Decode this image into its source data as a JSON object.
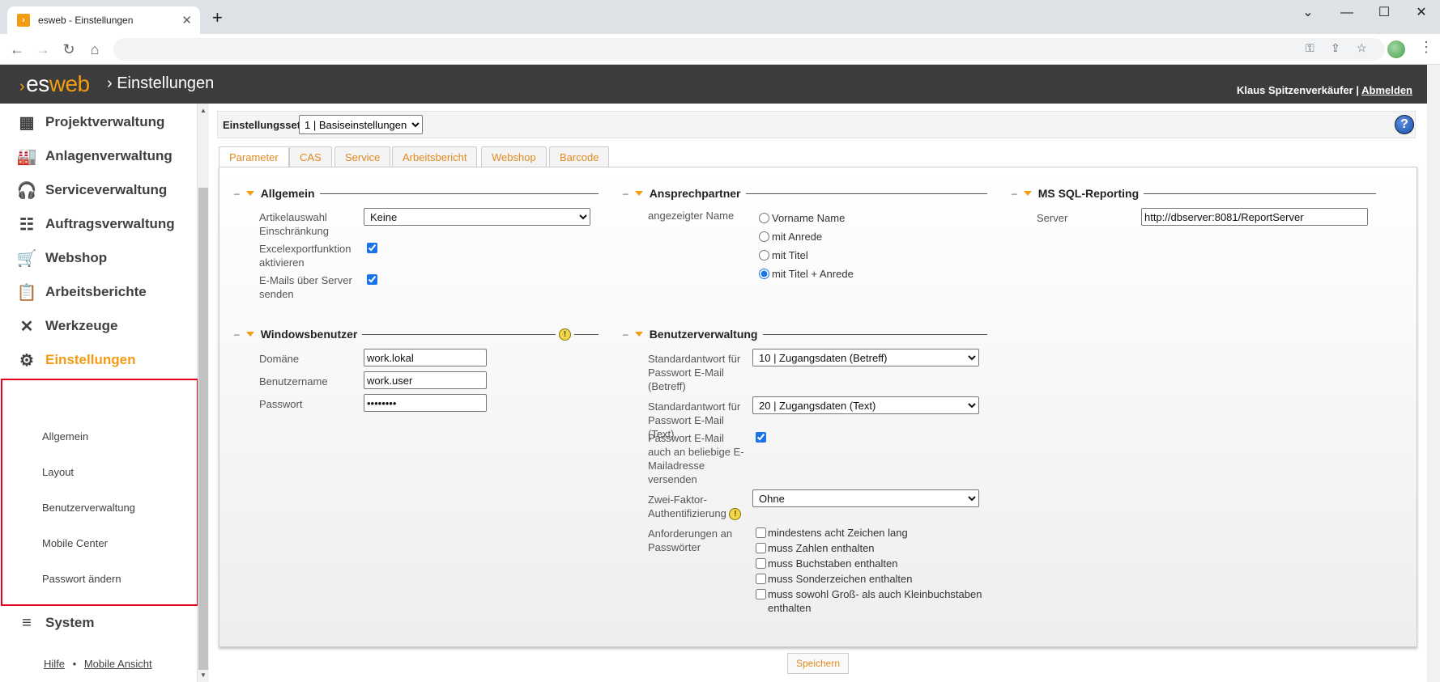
{
  "browser": {
    "tab_title": "esweb - Einstellungen",
    "favicon": "esweb-favicon",
    "new_tab": "+",
    "close_tab": "✕",
    "minimize": "⌄",
    "win_min": "—",
    "win_max": "☐",
    "win_close": "✕"
  },
  "header": {
    "logo_es": "es",
    "logo_web": "web",
    "title": "› Einstellungen",
    "user": "Klaus Spitzenverkäufer",
    "separator": "|",
    "logout": "Abmelden"
  },
  "sidebar": {
    "items": [
      {
        "label": "Projektverwaltung",
        "icon": "project-grid-icon"
      },
      {
        "label": "Anlagenverwaltung",
        "icon": "factory-icon"
      },
      {
        "label": "Serviceverwaltung",
        "icon": "headset-icon"
      },
      {
        "label": "Auftragsverwaltung",
        "icon": "list-icon"
      },
      {
        "label": "Webshop",
        "icon": "cart-icon"
      },
      {
        "label": "Arbeitsberichte",
        "icon": "clipboard-icon"
      },
      {
        "label": "Werkzeuge",
        "icon": "tools-icon"
      },
      {
        "label": "Einstellungen",
        "icon": "gears-icon"
      },
      {
        "label": "System",
        "icon": "database-icon"
      }
    ],
    "subitems": [
      "Allgemein",
      "Layout",
      "Benutzerverwaltung",
      "Mobile Center",
      "Passwort ändern"
    ],
    "footer": {
      "help": "Hilfe",
      "dot": "•",
      "mobile": "Mobile Ansicht"
    }
  },
  "settingsbar": {
    "label": "Einstellungsset",
    "selected": "1 | Basiseinstellungen"
  },
  "tabs": [
    "Parameter",
    "CAS",
    "Service",
    "Arbeitsbericht",
    "Webshop",
    "Barcode"
  ],
  "allgemein": {
    "title": "Allgemein",
    "artikel_label": "Artikelauswahl Einschränkung",
    "artikel_value": "Keine",
    "excel_label": "Excelexportfunktion aktivieren",
    "excel_checked": true,
    "email_label": "E-Mails über Server senden",
    "email_checked": true
  },
  "ansprech": {
    "title": "Ansprechpartner",
    "label": "angezeigter Name",
    "options": [
      "Vorname Name",
      "mit Anrede",
      "mit Titel",
      "mit Titel + Anrede"
    ],
    "selected_index": 3
  },
  "mssql": {
    "title": "MS SQL-Reporting",
    "server_label": "Server",
    "server_value": "http://dbserver:8081/ReportServer"
  },
  "windows": {
    "title": "Windowsbenutzer",
    "domain_label": "Domäne",
    "domain_value": "work.lokal",
    "user_label": "Benutzername",
    "user_value": "work.user",
    "pw_label": "Passwort",
    "pw_value": "••••••••"
  },
  "benutzer": {
    "title": "Benutzerverwaltung",
    "betreff_label": "Standardantwort für Passwort E-Mail (Betreff)",
    "betreff_value": "10 | Zugangsdaten (Betreff)",
    "text_label": "Standardantwort für Passwort E-Mail (Text)",
    "text_value": "20 | Zugangsdaten (Text)",
    "any_label": "Passwort E-Mail auch an beliebige E-Mailadresse versenden",
    "any_checked": true,
    "twofa_label": "Zwei-Faktor-Authentifizierung",
    "twofa_value": "Ohne",
    "req_label": "Anforderungen an Passwörter",
    "requirements": [
      "mindestens acht Zeichen lang",
      "muss Zahlen enthalten",
      "muss Buchstaben enthalten",
      "muss Sonderzeichen enthalten",
      "muss sowohl Groß- als auch Kleinbuchstaben enthalten"
    ]
  },
  "save_label": "Speichern",
  "warn_symbol": "!",
  "help_symbol": "?",
  "colors": {
    "accent": "#f39c12",
    "header": "#3c3c3c",
    "highlight": "#e3001b"
  }
}
